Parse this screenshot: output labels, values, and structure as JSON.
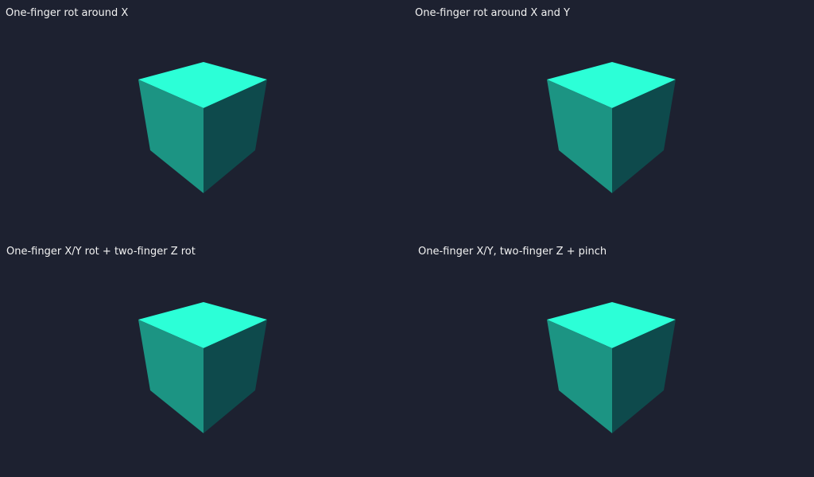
{
  "panels": [
    {
      "label": "One-finger rot around X"
    },
    {
      "label": "One-finger rot around X and Y"
    },
    {
      "label": "One-finger X/Y rot + two-finger Z rot"
    },
    {
      "label": "One-finger X/Y, two-finger Z + pinch"
    }
  ],
  "colors": {
    "background": "#1d2130",
    "cube_top": "#2cffd7",
    "cube_left": "#1c9483",
    "cube_right": "#0e4a4c",
    "label_text": "#f2f2f2"
  }
}
